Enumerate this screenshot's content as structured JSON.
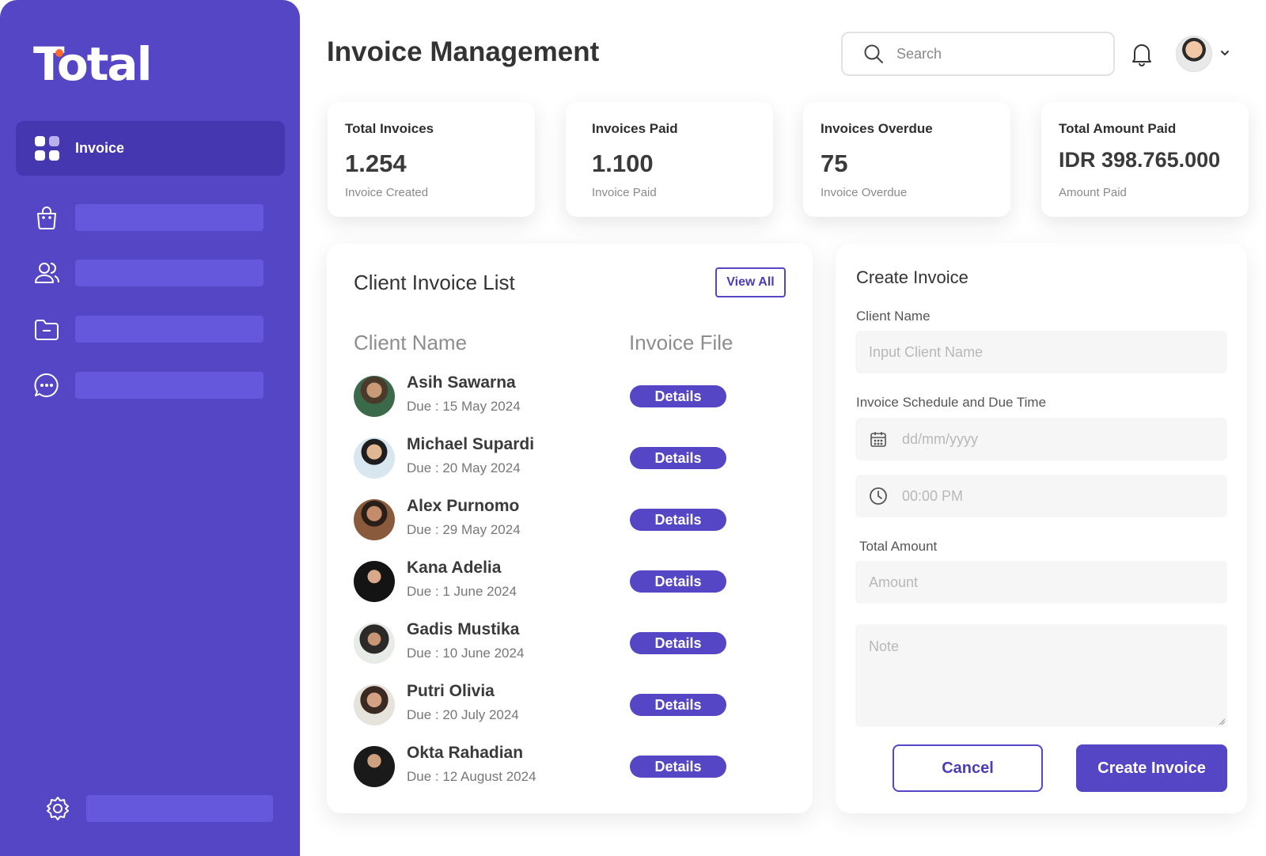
{
  "brand": {
    "name": "Total",
    "accent_color": "#5446c4",
    "dot_color": "#ff6a2b"
  },
  "sidebar": {
    "active_item": {
      "label": "Invoice",
      "icon": "grid-icon"
    },
    "items": [
      {
        "icon": "shopping-bag-icon"
      },
      {
        "icon": "users-icon"
      },
      {
        "icon": "folder-icon"
      },
      {
        "icon": "chat-icon"
      }
    ],
    "settings": {
      "icon": "gear-icon"
    }
  },
  "header": {
    "title": "Invoice Management",
    "search_placeholder": "Search"
  },
  "stats": [
    {
      "title": "Total Invoices",
      "value": "1.254",
      "sub": "Invoice Created"
    },
    {
      "title": "Invoices Paid",
      "value": "1.100",
      "sub": "Invoice Paid"
    },
    {
      "title": "Invoices Overdue",
      "value": "75",
      "sub": "Invoice Overdue"
    },
    {
      "title": "Total Amount Paid",
      "value": "IDR 398.765.000",
      "sub": "Amount Paid"
    }
  ],
  "client_list": {
    "title": "Client Invoice List",
    "view_all": "View All",
    "columns": [
      "Client Name",
      "Invoice File"
    ],
    "button_label": "Details",
    "rows": [
      {
        "name": "Asih Sawarna",
        "due": "Due : 15 May 2024"
      },
      {
        "name": "Michael Supardi",
        "due": "Due : 20 May 2024"
      },
      {
        "name": "Alex Purnomo",
        "due": "Due : 29 May 2024"
      },
      {
        "name": "Kana Adelia",
        "due": "Due : 1 June 2024"
      },
      {
        "name": "Gadis Mustika",
        "due": "Due : 10 June 2024"
      },
      {
        "name": "Putri Olivia",
        "due": "Due : 20 July 2024"
      },
      {
        "name": "Okta Rahadian",
        "due": "Due : 12 August 2024"
      }
    ]
  },
  "create_invoice": {
    "title": "Create Invoice",
    "client_name_label": "Client Name",
    "client_name_placeholder": "Input Client Name",
    "schedule_label": "Invoice Schedule and Due Time",
    "date_placeholder": "dd/mm/yyyy",
    "time_placeholder": "00:00 PM",
    "amount_label": "Total Amount",
    "amount_placeholder": "Amount",
    "note_placeholder": "Note",
    "cancel_label": "Cancel",
    "create_label": "Create Invoice"
  }
}
